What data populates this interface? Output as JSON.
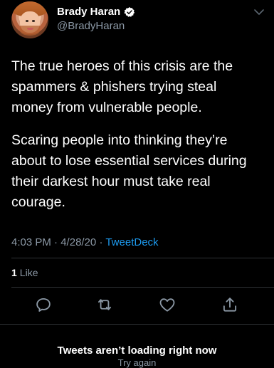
{
  "author": {
    "name": "Brady Haran",
    "handle": "@BradyHaran",
    "verified": true
  },
  "tweet": {
    "paragraphs": [
      "The true heroes of this crisis are the spammers & phishers trying steal money from vulnerable people.",
      "Scaring people into thinking they’re about to lose essential services during their darkest hour must take real courage."
    ],
    "time": "4:03 PM",
    "date": "4/28/20",
    "source": "TweetDeck"
  },
  "stats": {
    "likes_count": "1",
    "likes_label": "Like"
  },
  "footer": {
    "error": "Tweets aren’t loading right now",
    "retry": "Try again"
  },
  "colors": {
    "background": "#000000",
    "text": "#ffffff",
    "muted": "#8b98a5",
    "link": "#1d9bf0",
    "divider": "#2f3336"
  }
}
